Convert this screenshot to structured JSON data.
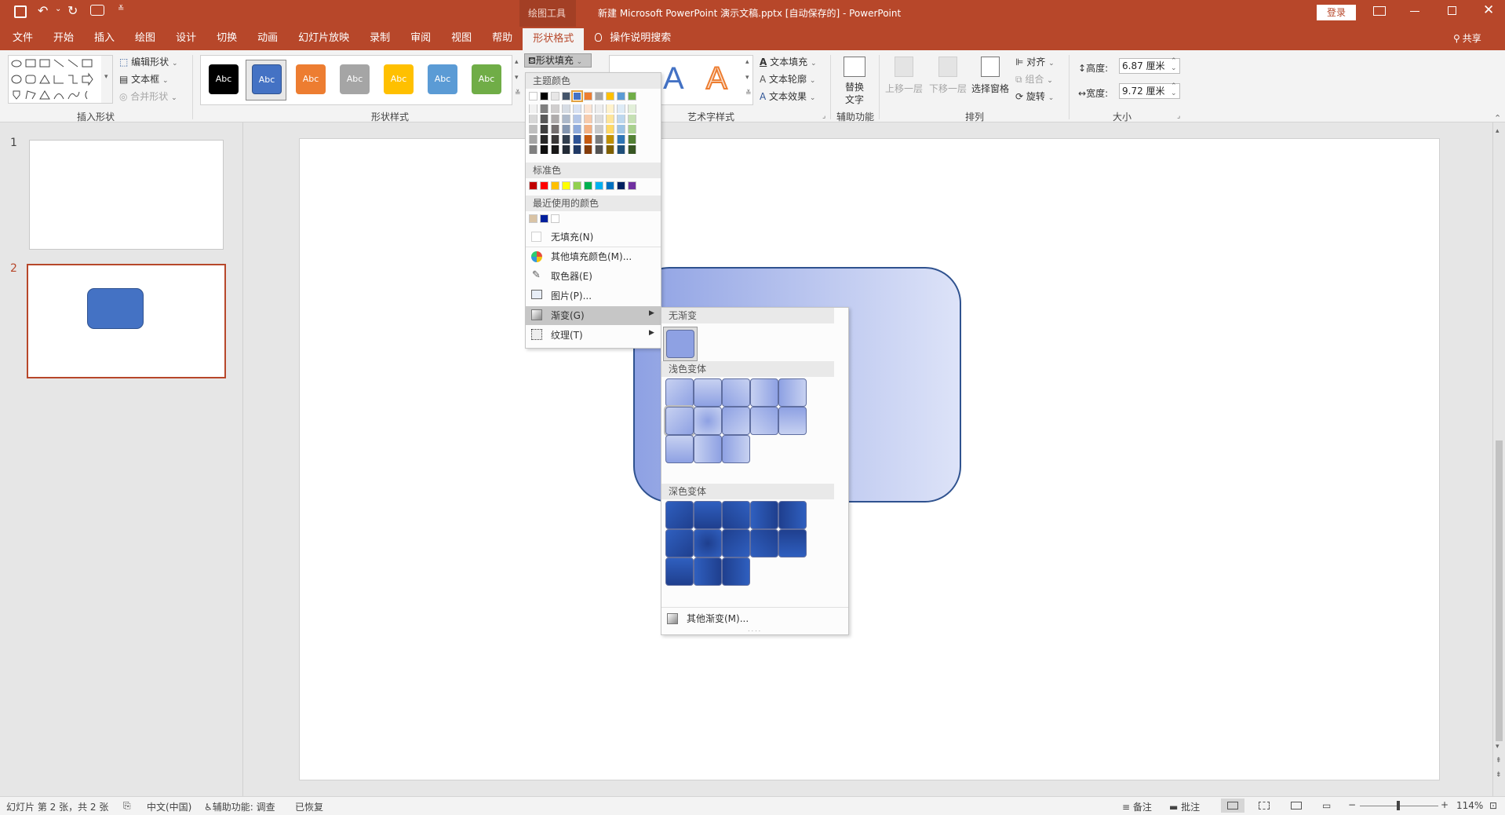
{
  "title_bar": {
    "context_tab_label": "绘图工具",
    "window_title": "新建 Microsoft PowerPoint 演示文稿.pptx [自动保存的]  -  PowerPoint",
    "login_label": "登录",
    "share_label": "共享",
    "qat_undo_arrow": "⌄",
    "qat_customize": "≚"
  },
  "tabs": [
    "文件",
    "开始",
    "插入",
    "绘图",
    "设计",
    "切换",
    "动画",
    "幻灯片放映",
    "录制",
    "审阅",
    "视图",
    "帮助",
    "形状格式"
  ],
  "tell_me": "操作说明搜索",
  "ribbon": {
    "insert_shapes": {
      "label": "插入形状",
      "edit_shape": "编辑形状",
      "text_box": "文本框",
      "merge_shapes": "合并形状"
    },
    "shape_styles": {
      "label": "形状样式",
      "style_text": "Abc",
      "style_colors": [
        "#000000",
        "#4472c4",
        "#ed7d31",
        "#a5a5a5",
        "#ffc000",
        "#5b9bd5",
        "#70ad47"
      ],
      "shape_fill": "形状填充"
    },
    "wordart": {
      "label": "艺术字样式",
      "letter": "A",
      "text_fill": "文本填充",
      "text_outline": "文本轮廓",
      "text_effects": "文本效果"
    },
    "accessibility": {
      "label": "辅助功能",
      "alt_text_1": "替换",
      "alt_text_2": "文字"
    },
    "arrange": {
      "label": "排列",
      "bring_forward": "上移一层",
      "send_backward": "下移一层",
      "selection_pane": "选择窗格",
      "align": "对齐",
      "group": "组合",
      "rotate": "旋转"
    },
    "size": {
      "label": "大小",
      "height_label": "高度:",
      "height_value": "6.87 厘米",
      "width_label": "宽度:",
      "width_value": "9.72 厘米"
    }
  },
  "fill_menu": {
    "theme_colors_header": "主题颜色",
    "theme_top": [
      "#ffffff",
      "#000000",
      "#e7e6e6",
      "#44546a",
      "#4472c4",
      "#ed7d31",
      "#a5a5a5",
      "#ffc000",
      "#5b9bd5",
      "#70ad47"
    ],
    "theme_shades": [
      [
        "#f2f2f2",
        "#7f7f7f",
        "#d0cece",
        "#d6dce4",
        "#d9e2f3",
        "#fbe5d5",
        "#ededed",
        "#fff2cc",
        "#deebf6",
        "#e2efd9"
      ],
      [
        "#d8d8d8",
        "#595959",
        "#aeabab",
        "#adb9ca",
        "#b4c6e7",
        "#f7cbac",
        "#dbdbdb",
        "#fee599",
        "#bdd7ee",
        "#c5e0b3"
      ],
      [
        "#bfbfbf",
        "#3f3f3f",
        "#757070",
        "#8496b0",
        "#8eaadb",
        "#f4b183",
        "#c9c9c9",
        "#ffd965",
        "#9cc3e5",
        "#a8d08d"
      ],
      [
        "#a5a5a5",
        "#262626",
        "#3a3838",
        "#323f4f",
        "#2f5496",
        "#c55a11",
        "#7b7b7b",
        "#bf9000",
        "#2e75b5",
        "#538135"
      ],
      [
        "#7f7f7f",
        "#0c0c0c",
        "#171616",
        "#222a35",
        "#1f3864",
        "#833c0b",
        "#525252",
        "#7f6000",
        "#1e4e79",
        "#375623"
      ]
    ],
    "standard_header": "标准色",
    "standard_colors": [
      "#c00000",
      "#ff0000",
      "#ffc000",
      "#ffff00",
      "#92d050",
      "#00b050",
      "#00b0f0",
      "#0070c0",
      "#002060",
      "#7030a0"
    ],
    "recent_header": "最近使用的颜色",
    "recent_colors": [
      "#d9c3a5",
      "#001f9c",
      "#ffffff"
    ],
    "no_fill": "无填充(N)",
    "more_colors": "其他填充颜色(M)...",
    "eyedropper": "取色器(E)",
    "picture": "图片(P)...",
    "gradient": "渐变(G)",
    "texture": "纹理(T)"
  },
  "gradient_menu": {
    "no_gradient_header": "无渐变",
    "light_header": "浅色变体",
    "dark_header": "深色变体",
    "more_gradients": "其他渐变(M)...",
    "light_colors": [
      "#c7d1f1",
      "#8ea1e3"
    ],
    "dark_colors": [
      "#2f5fbf",
      "#1f3f8e"
    ]
  },
  "thumbnails": {
    "slide1_number": "1",
    "slide2_number": "2"
  },
  "statusbar": {
    "slide_info": "幻灯片 第 2 张，共 2 张",
    "language": "中文(中国)",
    "accessibility": "辅助功能: 调查",
    "recovered": "已恢复",
    "notes": "备注",
    "comments": "批注",
    "zoom": "114%"
  },
  "colors": {
    "accent": "#b7472a",
    "shape": "#4472c4"
  }
}
